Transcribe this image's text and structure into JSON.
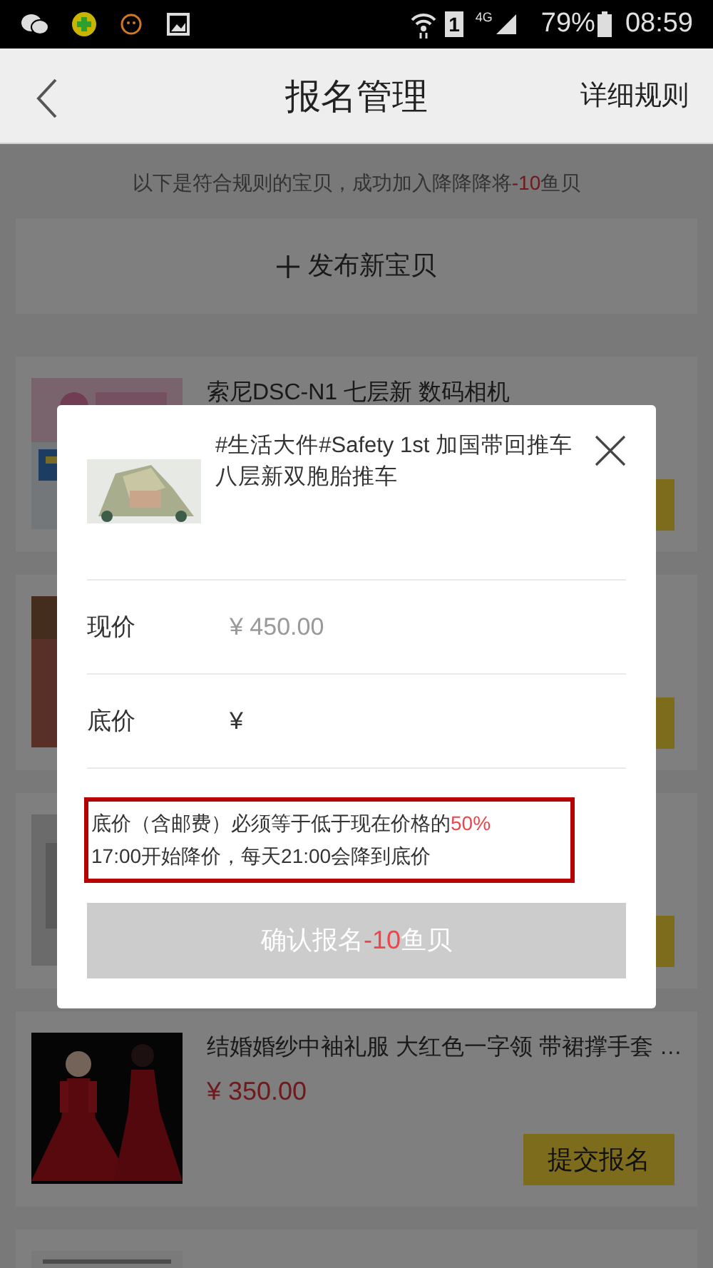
{
  "status_bar": {
    "sim": "1",
    "network": "4G",
    "battery": "79%",
    "time": "08:59"
  },
  "header": {
    "title": "报名管理",
    "action": "详细规则"
  },
  "notice": [
    {
      "text": "以下是符合规则的宝贝，成功加入降降降将",
      "highlight": false
    },
    {
      "text": "-10",
      "highlight": true
    },
    {
      "text": "鱼贝",
      "highlight": false
    }
  ],
  "publish_button": "发布新宝贝",
  "items": [
    {
      "title": "索尼DSC-N1 七层新 数码相机",
      "has_button": true
    },
    {
      "has_button": true
    },
    {
      "has_button": true
    },
    {
      "title": "结婚婚纱中袖礼服 大红色一字领 带裙撑手套 …",
      "price": "¥ 350.00",
      "button_label": "提交报名",
      "has_button": true
    },
    {
      "has_button": false
    }
  ],
  "modal": {
    "title": "#生活大件#Safety 1st 加国带回推车八层新双胞胎推车",
    "rows": [
      {
        "label": "现价",
        "value": "¥ 450.00",
        "kind": "readonly"
      },
      {
        "label": "底价",
        "value": "¥",
        "kind": "input"
      }
    ],
    "note_highlighted": true,
    "note_lines": [
      [
        {
          "text": "底价（含邮费）必须等于低于现在价格的",
          "highlight": false
        },
        {
          "text": "50%",
          "highlight": true
        }
      ],
      [
        {
          "text": "17:00开始降价，每天21:00会降到底价",
          "highlight": false
        }
      ]
    ],
    "confirm_disabled": true,
    "confirm": [
      {
        "text": "确认报名",
        "highlight": false
      },
      {
        "text": "-10",
        "highlight": true
      },
      {
        "text": "鱼贝",
        "highlight": false
      }
    ]
  }
}
